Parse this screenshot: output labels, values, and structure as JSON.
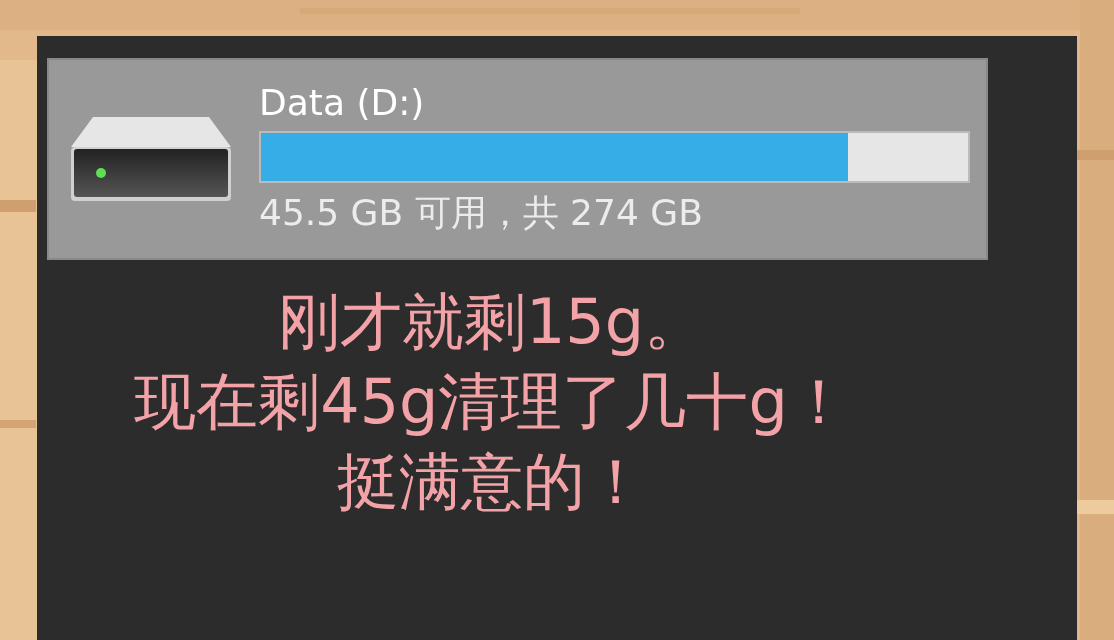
{
  "drive": {
    "name": "Data (D:)",
    "level": 0.83,
    "usage": "45.5 GB 可用，共 274 GB"
  },
  "caption": [
    "刚才就剩15g。",
    "现在剩45g清理了几十g！",
    "挺满意的！"
  ]
}
